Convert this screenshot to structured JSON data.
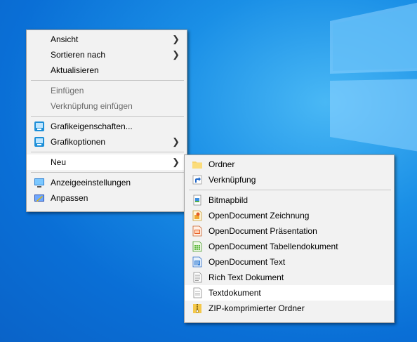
{
  "context_menu": {
    "items": [
      {
        "label": "Ansicht"
      },
      {
        "label": "Sortieren nach"
      },
      {
        "label": "Aktualisieren"
      },
      {
        "label": "Einfügen"
      },
      {
        "label": "Verknüpfung einfügen"
      },
      {
        "label": "Grafikeigenschaften..."
      },
      {
        "label": "Grafikoptionen"
      },
      {
        "label": "Neu"
      },
      {
        "label": "Anzeigeeinstellungen"
      },
      {
        "label": "Anpassen"
      }
    ]
  },
  "new_submenu": {
    "items": [
      {
        "label": "Ordner"
      },
      {
        "label": "Verknüpfung"
      },
      {
        "label": "Bitmapbild"
      },
      {
        "label": "OpenDocument Zeichnung"
      },
      {
        "label": "OpenDocument Präsentation"
      },
      {
        "label": "OpenDocument Tabellendokument"
      },
      {
        "label": "OpenDocument Text"
      },
      {
        "label": "Rich Text Dokument"
      },
      {
        "label": "Textdokument"
      },
      {
        "label": "ZIP-komprimierter Ordner"
      }
    ]
  },
  "icons": {
    "intel": "intel-graphics-icon",
    "display": "display-settings-icon",
    "personalize": "personalize-icon",
    "folder": "folder-icon",
    "shortcut": "shortcut-icon",
    "bitmap": "bitmap-icon",
    "odg": "opendocument-drawing-icon",
    "odp": "opendocument-presentation-icon",
    "ods": "opendocument-spreadsheet-icon",
    "odt": "opendocument-text-icon",
    "rtf": "rich-text-icon",
    "txt": "text-document-icon",
    "zip": "zip-folder-icon"
  },
  "colors": {
    "desktop": "#0a6fd6",
    "menu_bg": "#f2f2f2",
    "hover_bg": "#ffffff",
    "disabled_text": "#6d6d6d"
  }
}
